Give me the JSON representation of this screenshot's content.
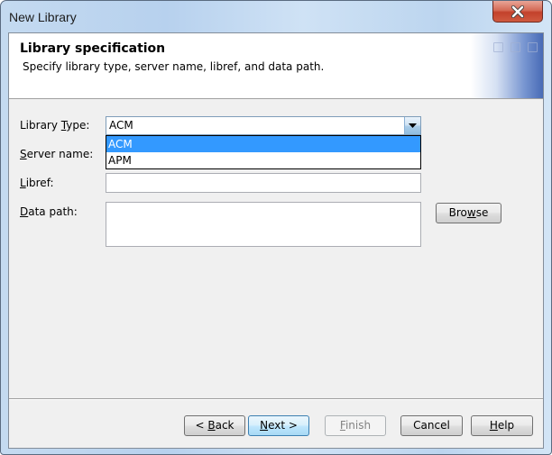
{
  "window": {
    "title": "New Library",
    "close_label": "Close"
  },
  "header": {
    "title": "Library specification",
    "subtitle": "Specify library type, server name, libref, and data path."
  },
  "form": {
    "library_type": {
      "label_pre": "Library ",
      "label_mnemonic": "T",
      "label_post": "ype:",
      "value": "ACM",
      "options": [
        {
          "label": "ACM",
          "selected": true
        },
        {
          "label": "APM",
          "selected": false
        }
      ]
    },
    "server_name": {
      "label_mnemonic": "S",
      "label_post": "erver name:",
      "value": ""
    },
    "libref": {
      "label_mnemonic": "L",
      "label_post": "ibref:",
      "value": ""
    },
    "data_path": {
      "label_mnemonic": "D",
      "label_post": "ata path:",
      "value": ""
    },
    "browse": {
      "pre": "Bro",
      "mnemonic": "w",
      "post": "se"
    }
  },
  "footer": {
    "back": {
      "pre": "< ",
      "mnemonic": "B",
      "post": "ack"
    },
    "next": {
      "pre": "",
      "mnemonic": "N",
      "post": "ext >"
    },
    "finish": {
      "pre": "",
      "mnemonic": "F",
      "post": "inish"
    },
    "cancel": {
      "label": "Cancel"
    },
    "help": {
      "pre": "",
      "mnemonic": "H",
      "post": "elp"
    }
  }
}
